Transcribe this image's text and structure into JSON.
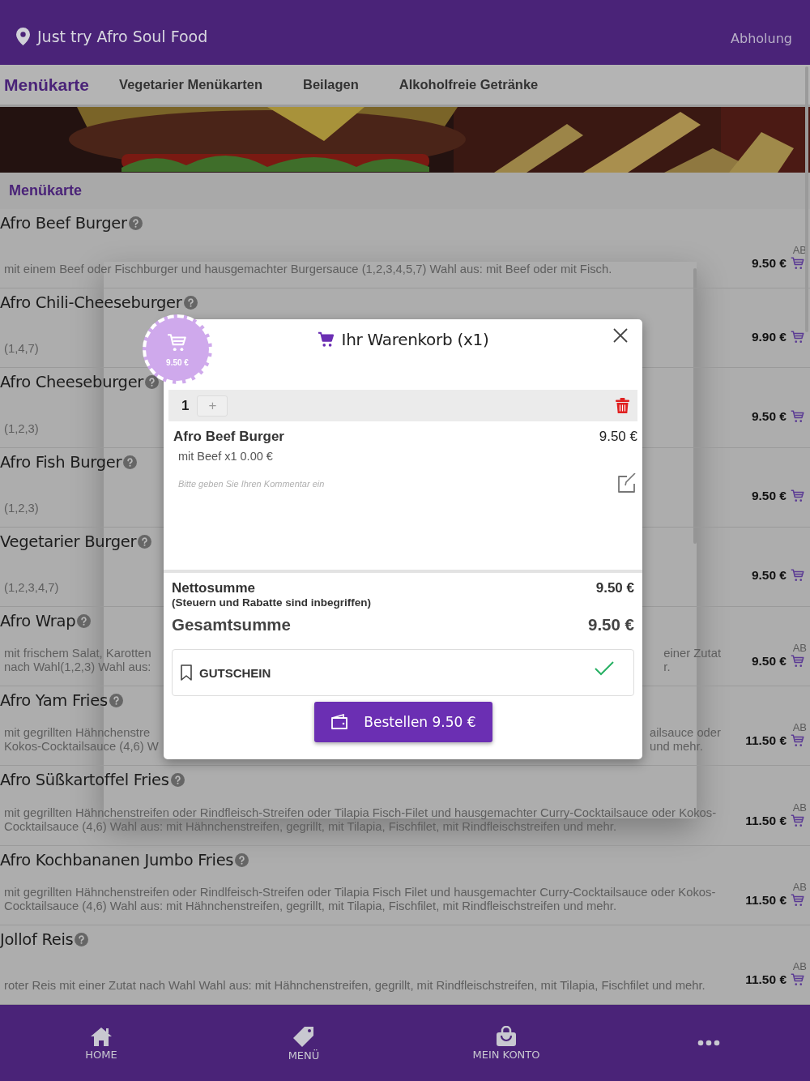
{
  "header": {
    "location": "Just try Afro Soul Food",
    "mode": "Abholung"
  },
  "tabs": [
    {
      "label": "Menükarte",
      "selected": true
    },
    {
      "label": "Vegetarier Menükarten",
      "selected": false
    },
    {
      "label": "Beilagen",
      "selected": false
    },
    {
      "label": "Alkoholfreie Getränke",
      "selected": false
    }
  ],
  "section_title": "Menükarte",
  "menu_items": [
    {
      "kind": "full",
      "name": "Afro Beef Burger",
      "description": "mit einem Beef oder Fischburger und hausgemachter Burgersauce (1,2,3,4,5,7) Wahl aus: mit Beef oder mit Fisch.",
      "from_label": "AB",
      "price": "9.50 €"
    },
    {
      "kind": "full",
      "name": "Afro Chili-Cheeseburger",
      "description": "(1,4,7)",
      "price": "9.90 €"
    },
    {
      "kind": "full",
      "name": "Afro Cheeseburger",
      "description": "(1,2,3)",
      "price": "9.50 €"
    },
    {
      "kind": "full",
      "name": "Afro Fish Burger",
      "description": "(1,2,3)",
      "price": "9.50 €"
    },
    {
      "kind": "full",
      "name": "Vegetarier Burger",
      "description": "(1,2,3,4,7)",
      "price": "9.50 €"
    },
    {
      "kind": "covered",
      "name": "Afro Wrap",
      "description_left": [
        "mit frischem Salat, Karotten",
        "nach Wahl(1,2,3) Wahl aus:"
      ],
      "description_right": [
        "einer Zutat",
        "r."
      ],
      "from_label": "AB",
      "price": "9.50 €"
    },
    {
      "kind": "covered",
      "name": "Afro Yam Fries",
      "description_left": [
        "mit gegrillten Hähnchenstre",
        "Kokos-Cocktailsauce (4,6) W"
      ],
      "description_right": [
        "ailsauce oder",
        "und mehr."
      ],
      "from_label": "AB",
      "price": "11.50 €"
    },
    {
      "kind": "full",
      "name": "Afro Süßkartoffel Fries",
      "description": "mit gegrillten Hähnchenstreifen oder Rindfleisch-Streifen oder Tilapia Fisch-Filet und hausgemachter Curry-Cocktailsauce oder Kokos-Cocktailsauce (4,6) Wahl aus: mit Hähnchenstreifen, gegrillt, mit Tilapia, Fischfilet, mit Rindfleischstreifen und mehr.",
      "from_label": "AB",
      "price": "11.50 €"
    },
    {
      "kind": "full",
      "name": "Afro Kochbananen Jumbo Fries",
      "description": "mit gegrillten Hähnchenstreifen oder Rindlfeisch-Streifen oder Tilapia Fisch Filet und hausgemachter Curry-Cocktailsauce oder Kokos-Cocktailsauce (4,6) Wahl aus: mit Hähnchenstreifen, gegrillt, mit Tilapia, Fischfilet, mit Rindfleischstreifen und mehr.",
      "from_label": "AB",
      "price": "11.50 €"
    },
    {
      "kind": "full",
      "name": "Jollof Reis",
      "description": "roter Reis mit einer Zutat nach Wahl Wahl aus: mit Hähnchenstreifen, gegrillt, mit Rindfleischstreifen, mit Tilapia, Fischfilet und mehr.",
      "from_label": "AB",
      "price": "11.50 €"
    }
  ],
  "cart_badge": {
    "amount": "9.50 €"
  },
  "cart": {
    "title": "Ihr Warenkorb (x1)",
    "quantity": "1",
    "increment": "+",
    "item": {
      "name": "Afro Beef Burger",
      "price": "9.50 €",
      "option": "mit Beef x1 0.00 €",
      "comment_placeholder": "Bitte geben Sie Ihren Kommentar ein"
    },
    "net_label": "Nettosumme",
    "net_value": "9.50 €",
    "tax_note": "(Steuern und Rabatte sind inbegriffen)",
    "total_label": "Gesamtsumme",
    "total_value": "9.50 €",
    "coupon": {
      "label": "GUTSCHEIN",
      "applied": true
    },
    "order_button": "Bestellen 9.50 €"
  },
  "bottom_nav": [
    {
      "kind": "home",
      "label": "HOME"
    },
    {
      "kind": "tag",
      "label": "MENÜ"
    },
    {
      "kind": "bag",
      "label": "MEIN KONTO"
    },
    {
      "kind": "more"
    }
  ]
}
